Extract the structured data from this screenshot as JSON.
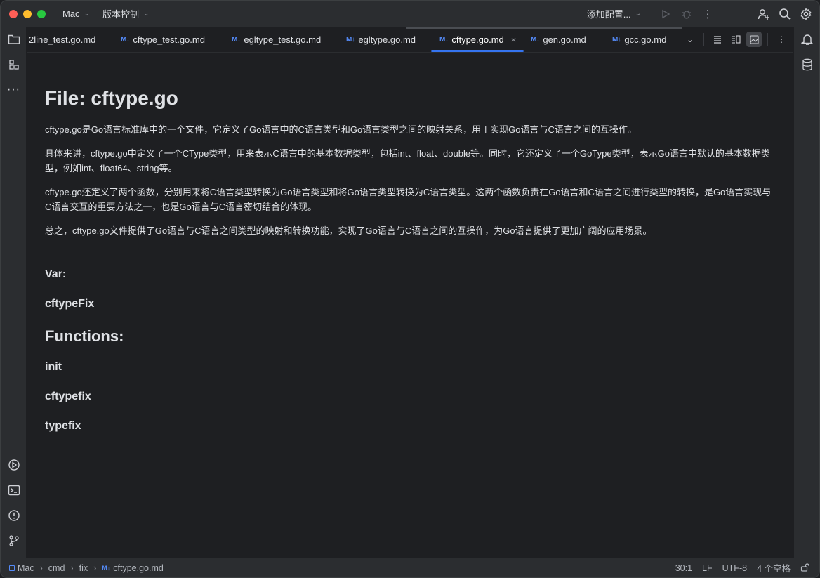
{
  "titlebar": {
    "project": "Mac",
    "vcs": "版本控制",
    "config": "添加配置..."
  },
  "tabs": [
    {
      "label": "2line_test.go.md",
      "md": false,
      "active": false
    },
    {
      "label": "cftype_test.go.md",
      "md": true,
      "active": false
    },
    {
      "label": "egltype_test.go.md",
      "md": true,
      "active": false
    },
    {
      "label": "egltype.go.md",
      "md": true,
      "active": false
    },
    {
      "label": "cftype.go.md",
      "md": true,
      "active": true
    },
    {
      "label": "gen.go.md",
      "md": true,
      "active": false
    },
    {
      "label": "gcc.go.md",
      "md": true,
      "active": false
    }
  ],
  "md_badge": "M↓",
  "doc": {
    "title": "File: cftype.go",
    "paragraphs": [
      "cftype.go是Go语言标准库中的一个文件，它定义了Go语言中的C语言类型和Go语言类型之间的映射关系，用于实现Go语言与C语言之间的互操作。",
      "具体来讲，cftype.go中定义了一个CType类型，用来表示C语言中的基本数据类型，包括int、float、double等。同时，它还定义了一个GoType类型，表示Go语言中默认的基本数据类型，例如int、float64、string等。",
      "cftype.go还定义了两个函数，分别用来将C语言类型转换为Go语言类型和将Go语言类型转换为C语言类型。这两个函数负责在Go语言和C语言之间进行类型的转换，是Go语言实现与C语言交互的重要方法之一，也是Go语言与C语言密切结合的体现。",
      "总之，cftype.go文件提供了Go语言与C语言之间类型的映射和转换功能，实现了Go语言与C语言之间的互操作，为Go语言提供了更加广阔的应用场景。"
    ],
    "var_heading": "Var:",
    "var_items": [
      "cftypeFix"
    ],
    "functions_heading": "Functions:",
    "function_items": [
      "init",
      "cftypefix",
      "typefix"
    ]
  },
  "statusbar": {
    "breadcrumb": [
      "Mac",
      "cmd",
      "fix",
      "cftype.go.md"
    ],
    "position": "30:1",
    "line_ending": "LF",
    "encoding": "UTF-8",
    "indent": "4 个空格"
  },
  "colors": {
    "accent": "#3574f0",
    "md_badge": "#548af7"
  }
}
